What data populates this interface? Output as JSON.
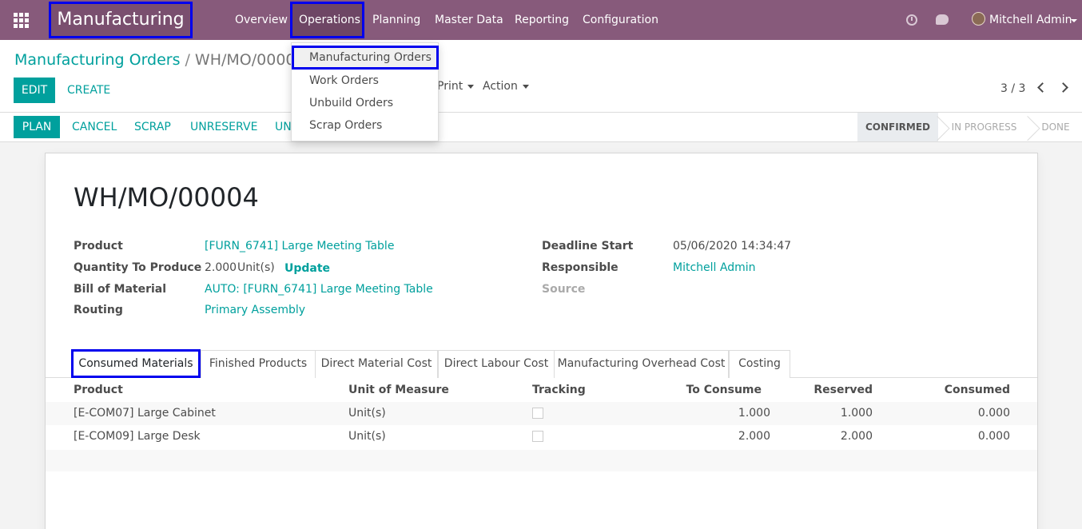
{
  "navbar": {
    "brand": "Manufacturing",
    "menu": [
      "Overview",
      "Operations",
      "Planning",
      "Master Data",
      "Reporting",
      "Configuration"
    ],
    "user": "Mitchell Admin"
  },
  "breadcrumb": {
    "parent": "Manufacturing Orders",
    "separator": "/",
    "current": "WH/MO/00004"
  },
  "buttons": {
    "edit": "EDIT",
    "create": "CREATE",
    "print": "Print",
    "action": "Action"
  },
  "pager": "3 / 3",
  "operations_menu": [
    "Manufacturing Orders",
    "Work Orders",
    "Unbuild Orders",
    "Scrap Orders"
  ],
  "statusbar": {
    "buttons": [
      "PLAN",
      "CANCEL",
      "SCRAP",
      "UNRESERVE",
      "UN"
    ],
    "stages": [
      "CONFIRMED",
      "IN PROGRESS",
      "DONE"
    ],
    "active_stage": "CONFIRMED"
  },
  "record": {
    "title": "WH/MO/00004",
    "fields_left": [
      {
        "label": "Product",
        "value": "[FURN_6741] Large Meeting Table"
      },
      {
        "label": "Quantity To Produce",
        "value": "2.000",
        "unit": "Unit(s)",
        "action": "Update"
      },
      {
        "label": "Bill of Material",
        "value": "AUTO: [FURN_6741] Large Meeting Table"
      },
      {
        "label": "Routing",
        "value": "Primary Assembly"
      }
    ],
    "fields_right": [
      {
        "label": "Deadline Start",
        "value": "05/06/2020 14:34:47"
      },
      {
        "label": "Responsible",
        "value": "Mitchell Admin"
      },
      {
        "label": "Source",
        "value": ""
      }
    ]
  },
  "tabs": [
    "Consumed Materials",
    "Finished Products",
    "Direct Material Cost",
    "Direct Labour Cost",
    "Manufacturing Overhead Cost",
    "Costing"
  ],
  "table": {
    "columns": [
      "Product",
      "Unit of Measure",
      "Tracking",
      "To Consume",
      "Reserved",
      "Consumed"
    ],
    "rows": [
      {
        "product": "[E-COM07] Large Cabinet",
        "uom": "Unit(s)",
        "tracking": false,
        "to_consume": "1.000",
        "reserved": "1.000",
        "consumed": "0.000"
      },
      {
        "product": "[E-COM09] Large Desk",
        "uom": "Unit(s)",
        "tracking": false,
        "to_consume": "2.000",
        "reserved": "2.000",
        "consumed": "0.000"
      }
    ]
  },
  "icons": [
    "apps-icon",
    "clock-icon",
    "chat-icon",
    "avatar",
    "chevron-left-icon",
    "chevron-right-icon"
  ],
  "colors": {
    "navbar": "#875a7b",
    "accent": "#00a09d",
    "highlight_border": "#0000ee"
  }
}
